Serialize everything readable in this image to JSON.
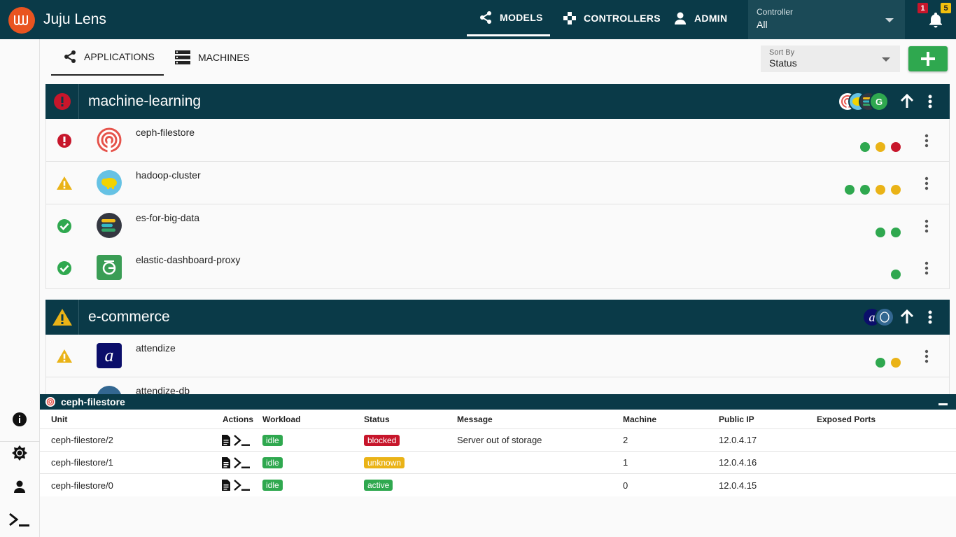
{
  "topbar": {
    "app_title": "Juju Lens",
    "nav": {
      "models": "MODELS",
      "controllers": "CONTROLLERS",
      "admin": "ADMIN"
    },
    "controller_select": {
      "label": "Controller",
      "value": "All"
    },
    "notifications": {
      "error_count": "1",
      "warning_count": "5"
    }
  },
  "tabs": {
    "applications": "APPLICATIONS",
    "machines": "MACHINES"
  },
  "sort": {
    "label": "Sort By",
    "value": "Status"
  },
  "models": [
    {
      "name": "machine-learning",
      "status": "error",
      "apps": [
        {
          "name": "ceph-filestore",
          "status": "error",
          "icon": "ceph-icon",
          "units": [
            "green",
            "yellow",
            "red"
          ]
        },
        {
          "name": "hadoop-cluster",
          "status": "warning",
          "icon": "hadoop-icon",
          "units": [
            "green",
            "green",
            "yellow",
            "yellow"
          ]
        },
        {
          "name": "es-for-big-data",
          "status": "ok",
          "icon": "elasticsearch-icon",
          "units": [
            "green",
            "green"
          ]
        },
        {
          "name": "elastic-dashboard-proxy",
          "status": "ok",
          "icon": "proxy-icon",
          "units": [
            "green"
          ]
        }
      ]
    },
    {
      "name": "e-commerce",
      "status": "warning",
      "apps": [
        {
          "name": "attendize",
          "status": "warning",
          "icon": "attendize-icon",
          "units": [
            "green",
            "yellow"
          ]
        },
        {
          "name": "attendize-db",
          "status": "ok",
          "icon": "postgresql-icon",
          "units": []
        }
      ]
    }
  ],
  "panel": {
    "title": "ceph-filestore",
    "columns": [
      "Unit",
      "Actions",
      "Workload",
      "Status",
      "Message",
      "Machine",
      "Public IP",
      "Exposed Ports"
    ],
    "rows": [
      {
        "unit": "ceph-filestore/2",
        "workload": "idle",
        "status": "blocked",
        "message": "Server out of storage",
        "machine": "2",
        "ip": "12.0.4.17",
        "ports": ""
      },
      {
        "unit": "ceph-filestore/1",
        "workload": "idle",
        "status": "unknown",
        "message": "",
        "machine": "1",
        "ip": "12.0.4.16",
        "ports": ""
      },
      {
        "unit": "ceph-filestore/0",
        "workload": "idle",
        "status": "active",
        "message": "",
        "machine": "0",
        "ip": "12.0.4.15",
        "ports": ""
      }
    ]
  },
  "colors": {
    "header": "#0a3a48",
    "green": "#2fa84f",
    "yellow": "#eab317",
    "red": "#c7162b",
    "brand": "#e95420"
  }
}
